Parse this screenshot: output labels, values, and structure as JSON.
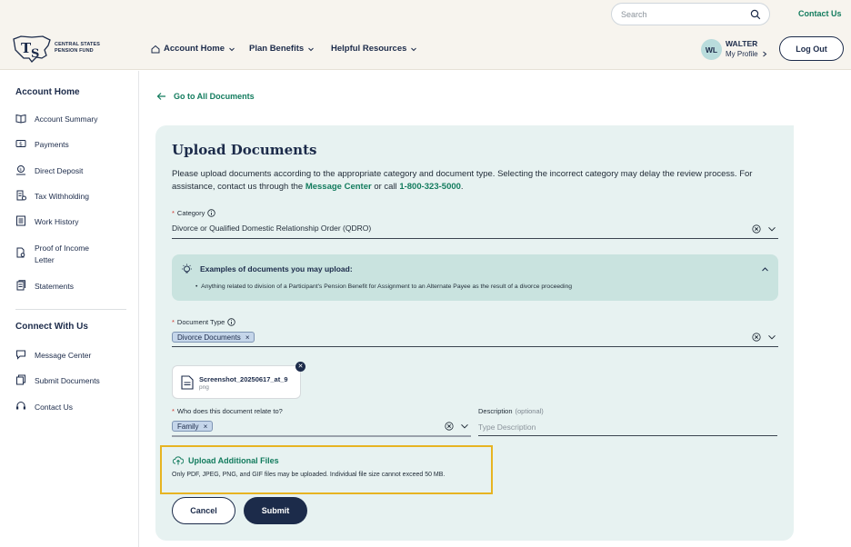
{
  "header": {
    "search_placeholder": "Search",
    "contact_us": "Contact Us",
    "logo_line1": "CENTRAL STATES",
    "logo_line2": "PENSION FUND",
    "nav": [
      {
        "label": "Account Home",
        "icon": "home-icon"
      },
      {
        "label": "Plan Benefits"
      },
      {
        "label": "Helpful Resources"
      }
    ],
    "user": {
      "initials": "WL",
      "name": "WALTER",
      "profile_label": "My Profile"
    },
    "logout_label": "Log Out"
  },
  "sidebar": {
    "heading_account": "Account Home",
    "account_items": [
      {
        "label": "Account Summary",
        "icon": "book-icon"
      },
      {
        "label": "Payments",
        "icon": "dollar-icon"
      },
      {
        "label": "Direct Deposit",
        "icon": "bank-icon"
      },
      {
        "label": "Tax Withholding",
        "icon": "tax-document-icon"
      },
      {
        "label": "Work History",
        "icon": "list-icon"
      },
      {
        "label": "Proof of Income Letter",
        "icon": "file-search-icon"
      },
      {
        "label": "Statements",
        "icon": "statements-icon"
      }
    ],
    "heading_connect": "Connect With Us",
    "connect_items": [
      {
        "label": "Message Center",
        "icon": "message-icon"
      },
      {
        "label": "Submit Documents",
        "icon": "documents-icon"
      },
      {
        "label": "Contact Us",
        "icon": "headset-icon"
      }
    ]
  },
  "main": {
    "back_link": "Go to All Documents",
    "title": "Upload Documents",
    "desc_part1": "Please upload documents according to the appropriate category and document type. Selecting the incorrect category may delay the review process. For assistance, contact us through the ",
    "desc_link": "Message Center",
    "desc_part2": " or call ",
    "desc_phone": "1-800-323-5000",
    "desc_part3": ".",
    "category": {
      "label": "Category",
      "value": "Divorce or Qualified Domestic Relationship Order (QDRO)"
    },
    "examples": {
      "title": "Examples of documents you may upload:",
      "bullet": "Anything related to division of a Participant's Pension Benefit for Assignment to an Alternate Payee as the result of a divorce proceeding"
    },
    "document_type": {
      "label": "Document Type",
      "chip": "Divorce Documents"
    },
    "file": {
      "name": "Screenshot_20250617_at_9",
      "ext": "png"
    },
    "relate": {
      "label": "Who does this document relate to?",
      "chip": "Family"
    },
    "description": {
      "label": "Description",
      "optional": "(optional)",
      "placeholder": "Type Description"
    },
    "upload": {
      "label": "Upload Additional Files",
      "note": "Only PDF, JPEG, PNG, and GIF files may be uploaded. Individual file size cannot exceed 50 MB."
    },
    "cancel_label": "Cancel",
    "submit_label": "Submit"
  },
  "colors": {
    "brand_navy": "#1c2b4a",
    "accent_green": "#137c5e",
    "card_bg": "#e7f2f1",
    "highlight": "#e7b422"
  }
}
